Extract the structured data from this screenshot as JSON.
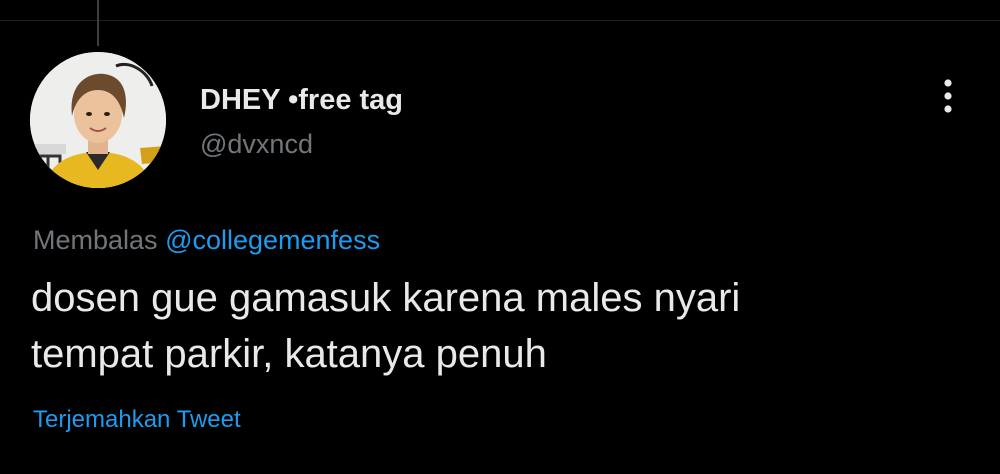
{
  "tweet": {
    "author": {
      "display_name": "DHEY •free tag",
      "handle": "@dvxncd",
      "avatar_icon": "profile-photo-avatar"
    },
    "more_icon": "more-options-icon",
    "reply": {
      "prefix": "Membalas",
      "mention": "@collegemenfess"
    },
    "text_lines": [
      "dosen gue gamasuk karena males nyari",
      "tempat parkir, katanya penuh"
    ],
    "translate_label": "Terjemahkan Tweet"
  },
  "colors": {
    "background": "#000000",
    "primary_text": "#e7e9ea",
    "secondary_text": "#71767b",
    "link": "#1d9bf0"
  }
}
